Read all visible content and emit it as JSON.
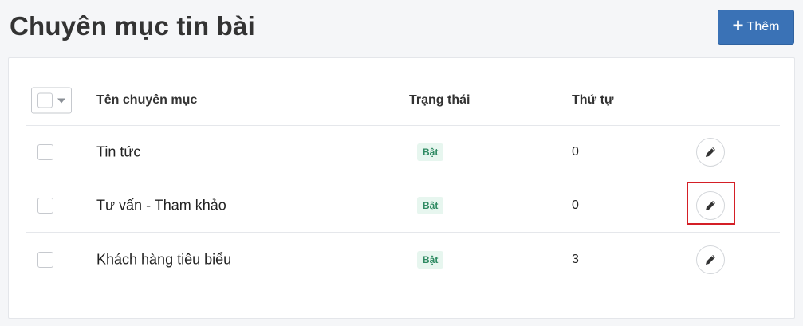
{
  "page": {
    "title": "Chuyên mục tin bài"
  },
  "toolbar": {
    "add_label": "Thêm",
    "add_icon": "plus-icon"
  },
  "table": {
    "columns": {
      "name": "Tên chuyên mục",
      "status": "Trạng thái",
      "order": "Thứ tự"
    },
    "rows": [
      {
        "name": "Tin tức",
        "status": "Bật",
        "order": "0",
        "highlighted": false
      },
      {
        "name": "Tư vấn - Tham khảo",
        "status": "Bật",
        "order": "0",
        "highlighted": true
      },
      {
        "name": "Khách hàng tiêu biểu",
        "status": "Bật",
        "order": "3",
        "highlighted": false
      }
    ]
  },
  "colors": {
    "primary": "#3a72b6",
    "badge_bg": "#e7f6ef",
    "badge_text": "#2e8a62",
    "highlight": "#d41f26"
  }
}
